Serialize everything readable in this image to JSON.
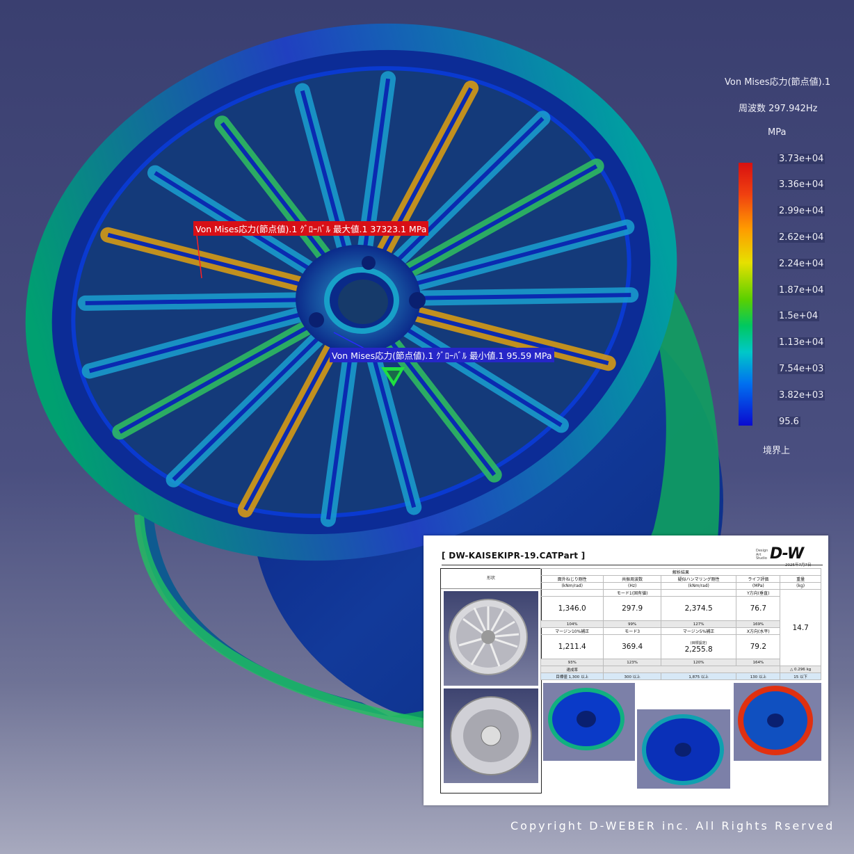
{
  "annotations": {
    "max_label": "Von Mises応力(節点値).1 ｸﾞﾛｰﾊﾞﾙ 最大値.1  37323.1 MPa",
    "min_label": "Von Mises応力(節点値).1 ｸﾞﾛｰﾊﾞﾙ 最小値.1  95.59 MPa"
  },
  "legend": {
    "title": "Von Mises応力(節点値).1",
    "frequency": "周波数 297.942Hz",
    "unit": "MPa",
    "ticks": [
      "3.73e+04",
      "3.36e+04",
      "2.99e+04",
      "2.62e+04",
      "2.24e+04",
      "1.87e+04",
      "1.5e+04",
      "1.13e+04",
      "7.54e+03",
      "3.82e+03",
      "95.6"
    ],
    "footer": "境界上",
    "colors": {
      "max": "#d81010",
      "mid": "#5ad000",
      "min": "#0a0ad0"
    }
  },
  "report": {
    "title": "[ DW-KAISEKIPR-19.CATPart ]",
    "logo_small": "Design\nArt\nStudio",
    "logo": "D-W",
    "date": "2025年7月7日",
    "shape_header": "形状",
    "results_header": "解析結果",
    "columns": [
      {
        "name": "面外ねじり剛性",
        "unit": "(kNm/rad)"
      },
      {
        "name": "共振周波数",
        "unit": "(Hz)"
      },
      {
        "name": "疑似ハンマリング剛性",
        "unit": "(kNm/rad)"
      },
      {
        "name": "ライフ評価",
        "unit": "(MPa)"
      },
      {
        "name": "重量",
        "unit": "(kg)"
      }
    ],
    "sub_row1": [
      "",
      "モード1(固有値)",
      "",
      "Y方向(垂直)"
    ],
    "row1_values": [
      "1,346.0",
      "297.9",
      "2,374.5",
      "76.7"
    ],
    "row1_pct": [
      "104%",
      "99%",
      "127%",
      "169%"
    ],
    "sub_row2": [
      "マージン10%補正",
      "モード3",
      "マージン5%補正",
      "X方向(水平)"
    ],
    "row2_values": [
      "1,211.4",
      "369.4",
      "2,255.8",
      "79.2"
    ],
    "row2_note": "(目標設定)",
    "row2_pct": [
      "93%",
      "123%",
      "120%",
      "164%"
    ],
    "weight_value": "14.7",
    "weight_delta": "△ 0.296",
    "weight_unit": "kg",
    "pct_label": "達成率",
    "target_label": "目標値",
    "targets": [
      "1,300",
      "300",
      "1,875",
      "130",
      "15"
    ],
    "target_suffix": [
      "以上",
      "以上",
      "以上",
      "以上",
      "以下"
    ]
  },
  "copyright": "Copyright D-WEBER inc. All Rights Rserved"
}
